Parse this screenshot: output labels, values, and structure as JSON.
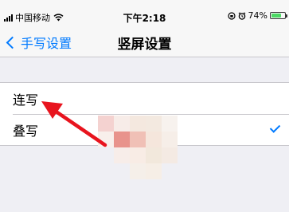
{
  "status_bar": {
    "carrier": "中国移动",
    "time": "下午2:18",
    "battery_percent": "74%",
    "battery_level": 0.74,
    "icons": [
      "signal-icon",
      "wifi-icon",
      "lock-rotation-icon",
      "alarm-icon",
      "battery-icon"
    ]
  },
  "nav": {
    "back_label": "手写设置",
    "title": "竖屏设置"
  },
  "list": {
    "items": [
      {
        "label": "连写",
        "selected": false
      },
      {
        "label": "叠写",
        "selected": true
      }
    ]
  },
  "colors": {
    "accent": "#007aff",
    "annotation_arrow": "#e8141e",
    "background": "#efeff4"
  }
}
